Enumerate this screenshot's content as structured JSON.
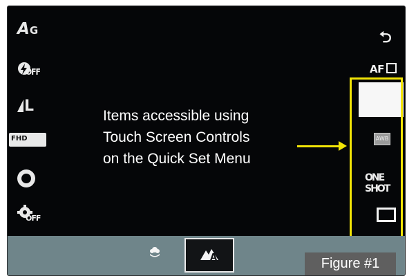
{
  "left_icons": {
    "auto_lighting": {
      "main": "A",
      "sub": "G"
    },
    "flash_off": {
      "label": "OFF"
    },
    "quality": {
      "label": "L"
    },
    "movie_size": {
      "label": "FHD"
    },
    "shooting_settings": {
      "icon": "globe-icon"
    },
    "self_timer_off": {
      "label": "OFF"
    }
  },
  "right_icons": {
    "back": {
      "icon": "return-arrow-icon",
      "glyph": "⮌"
    },
    "af_method": {
      "label": "AF"
    },
    "white_balance": {
      "label": "AWB"
    },
    "af_operation": {
      "label": "ONE SHOT"
    },
    "drive_mode": {
      "icon": "single-frame-icon"
    }
  },
  "annotation": {
    "line1": "Items accessible using",
    "line2": "Touch Screen Controls",
    "line3": "on the Quick Set Menu"
  },
  "bottom_bar": {
    "mode_icon": "flower-icon",
    "selected_mode": {
      "label": "A",
      "icon": "scene-intelligent-auto-icon"
    }
  },
  "figure_label": "Figure #1",
  "colors": {
    "highlight_yellow": "#f2e406",
    "bottom_bar": "#6f858a",
    "figure_label_bg": "#5f5f5f",
    "screen_bg": "#050608"
  }
}
